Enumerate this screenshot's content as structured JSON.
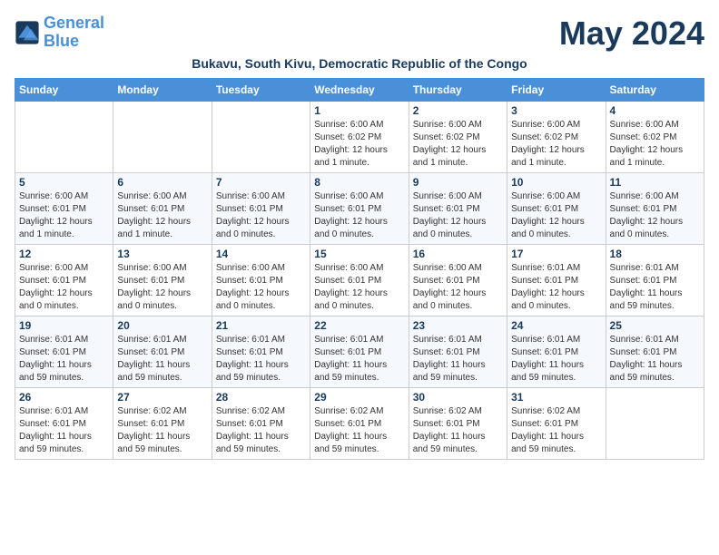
{
  "logo": {
    "line1": "General",
    "line2": "Blue"
  },
  "title": "May 2024",
  "subtitle": "Bukavu, South Kivu, Democratic Republic of the Congo",
  "days_of_week": [
    "Sunday",
    "Monday",
    "Tuesday",
    "Wednesday",
    "Thursday",
    "Friday",
    "Saturday"
  ],
  "weeks": [
    [
      {
        "day": "",
        "info": ""
      },
      {
        "day": "",
        "info": ""
      },
      {
        "day": "",
        "info": ""
      },
      {
        "day": "1",
        "info": "Sunrise: 6:00 AM\nSunset: 6:02 PM\nDaylight: 12 hours\nand 1 minute."
      },
      {
        "day": "2",
        "info": "Sunrise: 6:00 AM\nSunset: 6:02 PM\nDaylight: 12 hours\nand 1 minute."
      },
      {
        "day": "3",
        "info": "Sunrise: 6:00 AM\nSunset: 6:02 PM\nDaylight: 12 hours\nand 1 minute."
      },
      {
        "day": "4",
        "info": "Sunrise: 6:00 AM\nSunset: 6:02 PM\nDaylight: 12 hours\nand 1 minute."
      }
    ],
    [
      {
        "day": "5",
        "info": "Sunrise: 6:00 AM\nSunset: 6:01 PM\nDaylight: 12 hours\nand 1 minute."
      },
      {
        "day": "6",
        "info": "Sunrise: 6:00 AM\nSunset: 6:01 PM\nDaylight: 12 hours\nand 1 minute."
      },
      {
        "day": "7",
        "info": "Sunrise: 6:00 AM\nSunset: 6:01 PM\nDaylight: 12 hours\nand 0 minutes."
      },
      {
        "day": "8",
        "info": "Sunrise: 6:00 AM\nSunset: 6:01 PM\nDaylight: 12 hours\nand 0 minutes."
      },
      {
        "day": "9",
        "info": "Sunrise: 6:00 AM\nSunset: 6:01 PM\nDaylight: 12 hours\nand 0 minutes."
      },
      {
        "day": "10",
        "info": "Sunrise: 6:00 AM\nSunset: 6:01 PM\nDaylight: 12 hours\nand 0 minutes."
      },
      {
        "day": "11",
        "info": "Sunrise: 6:00 AM\nSunset: 6:01 PM\nDaylight: 12 hours\nand 0 minutes."
      }
    ],
    [
      {
        "day": "12",
        "info": "Sunrise: 6:00 AM\nSunset: 6:01 PM\nDaylight: 12 hours\nand 0 minutes."
      },
      {
        "day": "13",
        "info": "Sunrise: 6:00 AM\nSunset: 6:01 PM\nDaylight: 12 hours\nand 0 minutes."
      },
      {
        "day": "14",
        "info": "Sunrise: 6:00 AM\nSunset: 6:01 PM\nDaylight: 12 hours\nand 0 minutes."
      },
      {
        "day": "15",
        "info": "Sunrise: 6:00 AM\nSunset: 6:01 PM\nDaylight: 12 hours\nand 0 minutes."
      },
      {
        "day": "16",
        "info": "Sunrise: 6:00 AM\nSunset: 6:01 PM\nDaylight: 12 hours\nand 0 minutes."
      },
      {
        "day": "17",
        "info": "Sunrise: 6:01 AM\nSunset: 6:01 PM\nDaylight: 12 hours\nand 0 minutes."
      },
      {
        "day": "18",
        "info": "Sunrise: 6:01 AM\nSunset: 6:01 PM\nDaylight: 11 hours\nand 59 minutes."
      }
    ],
    [
      {
        "day": "19",
        "info": "Sunrise: 6:01 AM\nSunset: 6:01 PM\nDaylight: 11 hours\nand 59 minutes."
      },
      {
        "day": "20",
        "info": "Sunrise: 6:01 AM\nSunset: 6:01 PM\nDaylight: 11 hours\nand 59 minutes."
      },
      {
        "day": "21",
        "info": "Sunrise: 6:01 AM\nSunset: 6:01 PM\nDaylight: 11 hours\nand 59 minutes."
      },
      {
        "day": "22",
        "info": "Sunrise: 6:01 AM\nSunset: 6:01 PM\nDaylight: 11 hours\nand 59 minutes."
      },
      {
        "day": "23",
        "info": "Sunrise: 6:01 AM\nSunset: 6:01 PM\nDaylight: 11 hours\nand 59 minutes."
      },
      {
        "day": "24",
        "info": "Sunrise: 6:01 AM\nSunset: 6:01 PM\nDaylight: 11 hours\nand 59 minutes."
      },
      {
        "day": "25",
        "info": "Sunrise: 6:01 AM\nSunset: 6:01 PM\nDaylight: 11 hours\nand 59 minutes."
      }
    ],
    [
      {
        "day": "26",
        "info": "Sunrise: 6:01 AM\nSunset: 6:01 PM\nDaylight: 11 hours\nand 59 minutes."
      },
      {
        "day": "27",
        "info": "Sunrise: 6:02 AM\nSunset: 6:01 PM\nDaylight: 11 hours\nand 59 minutes."
      },
      {
        "day": "28",
        "info": "Sunrise: 6:02 AM\nSunset: 6:01 PM\nDaylight: 11 hours\nand 59 minutes."
      },
      {
        "day": "29",
        "info": "Sunrise: 6:02 AM\nSunset: 6:01 PM\nDaylight: 11 hours\nand 59 minutes."
      },
      {
        "day": "30",
        "info": "Sunrise: 6:02 AM\nSunset: 6:01 PM\nDaylight: 11 hours\nand 59 minutes."
      },
      {
        "day": "31",
        "info": "Sunrise: 6:02 AM\nSunset: 6:01 PM\nDaylight: 11 hours\nand 59 minutes."
      },
      {
        "day": "",
        "info": ""
      }
    ]
  ]
}
